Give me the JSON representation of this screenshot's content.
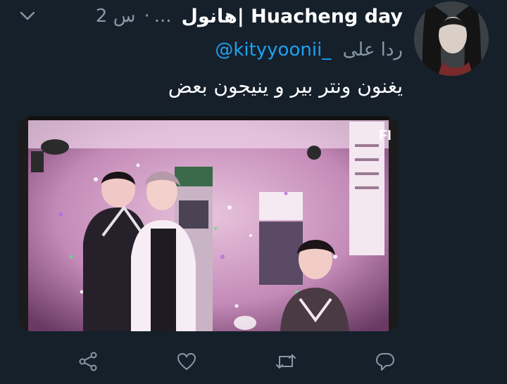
{
  "tweet": {
    "display_name": "هانول| Huacheng day",
    "ellipsis": "...",
    "dot": "·",
    "time": "2 س",
    "reply_label": "ردا على",
    "reply_handle": "@kityyoonii_",
    "text": "يغنون ونتر بير و ينيجون بعض"
  },
  "media": {
    "watermark": "FI"
  },
  "actions": [
    "share-icon",
    "like-icon",
    "retweet-icon",
    "reply-icon"
  ],
  "colors": {
    "background": "#15202b",
    "secondary_text": "#8899a6",
    "link": "#1da1f2",
    "icon": "#8899a6"
  }
}
